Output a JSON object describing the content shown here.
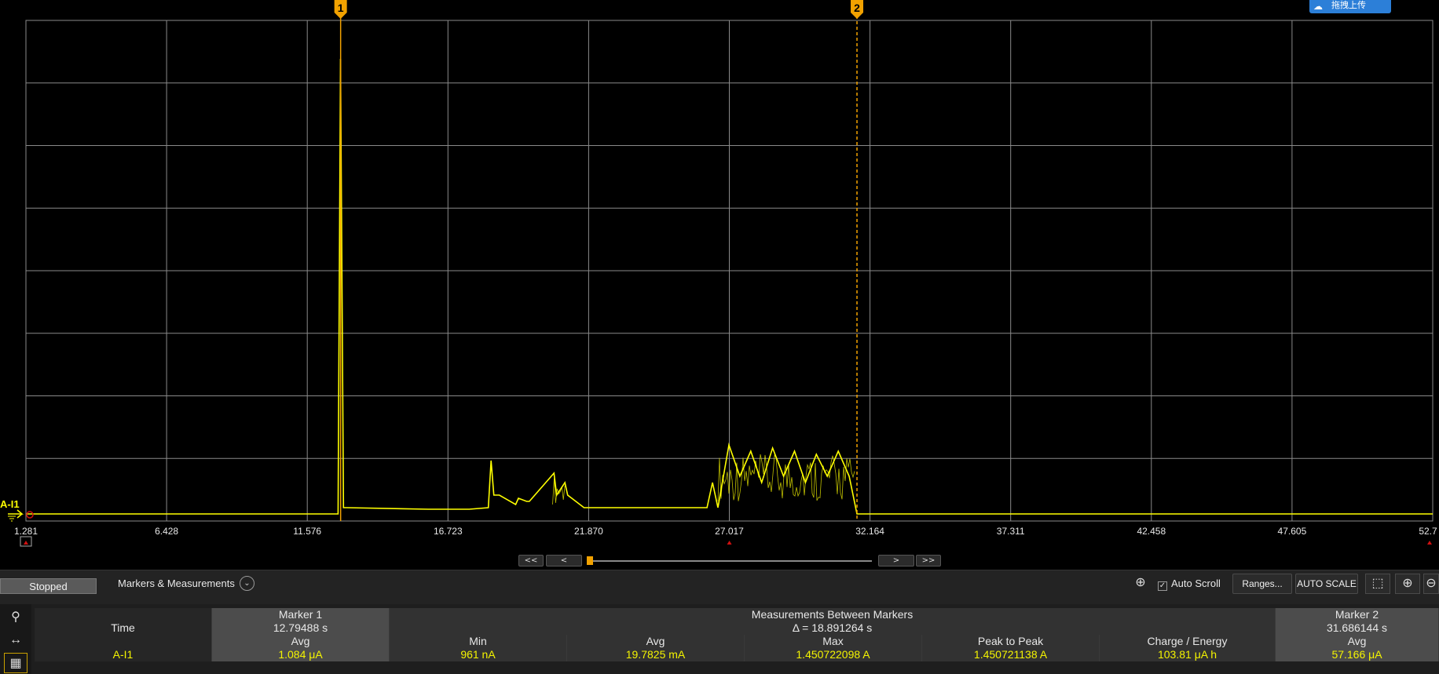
{
  "upload_button": {
    "label": "拖拽上传",
    "icon": "cloud-icon"
  },
  "chart_data": {
    "type": "line",
    "channel": "A-I1",
    "xlabel": "",
    "ylabel": "",
    "x_ticks": [
      "1.281",
      "6.428",
      "11.576",
      "16.723",
      "21.870",
      "27.017",
      "32.164",
      "37.311",
      "42.458",
      "47.605",
      "52.7"
    ],
    "x_range": [
      1.281,
      52.75
    ],
    "y_divisions": 8,
    "grid": true,
    "line_color": "#ffff00",
    "x": [
      1.281,
      12.7,
      12.79,
      12.9,
      13.0,
      16.0,
      17.5,
      18.2,
      18.3,
      18.4,
      18.6,
      19.2,
      19.3,
      19.6,
      19.7,
      20.6,
      20.7,
      21.0,
      21.1,
      21.7,
      21.9,
      26.2,
      26.4,
      26.6,
      27.0,
      27.4,
      27.8,
      28.2,
      28.6,
      29.0,
      29.4,
      29.8,
      30.2,
      30.6,
      31.0,
      31.4,
      31.686,
      31.8,
      52.75
    ],
    "y": [
      0.0,
      0.0,
      1.45,
      0.02,
      0.02,
      0.015,
      0.015,
      0.02,
      0.17,
      0.06,
      0.06,
      0.03,
      0.05,
      0.04,
      0.04,
      0.13,
      0.06,
      0.1,
      0.06,
      0.02,
      0.02,
      0.02,
      0.1,
      0.02,
      0.22,
      0.12,
      0.2,
      0.1,
      0.21,
      0.12,
      0.2,
      0.1,
      0.19,
      0.12,
      0.2,
      0.12,
      0.0,
      0.0,
      0.0
    ],
    "markers": [
      {
        "label": "1",
        "x": 12.79488
      },
      {
        "label": "2",
        "x": 31.686144
      }
    ]
  },
  "nav": {
    "first": "<<",
    "prev": "<",
    "next": ">",
    "last": ">>"
  },
  "status": "Stopped",
  "toolbar": {
    "markers_measurements": "Markers & Measurements",
    "auto_scroll": "Auto Scroll",
    "auto_scroll_checked": true,
    "ranges": "Ranges...",
    "auto_scale": "AUTO SCALE"
  },
  "measurements": {
    "marker1_header": "Marker 1",
    "between_header": "Measurements Between Markers",
    "marker2_header": "Marker 2",
    "time_label": "Time",
    "marker1_time": "12.79488 s",
    "delta": "Δ = 18.891264 s",
    "marker2_time": "31.686144 s",
    "col_avg": "Avg",
    "col_min": "Min",
    "col_max": "Max",
    "col_p2p": "Peak to Peak",
    "col_charge": "Charge / Energy",
    "channel": "A-I1",
    "marker1_avg": "1.084 μA",
    "min": "961 nA",
    "avg": "19.7825 mA",
    "max": "1.450722098 A",
    "p2p": "1.450721138 A",
    "charge": "103.81 μA h",
    "marker2_avg": "57.166 μA"
  }
}
